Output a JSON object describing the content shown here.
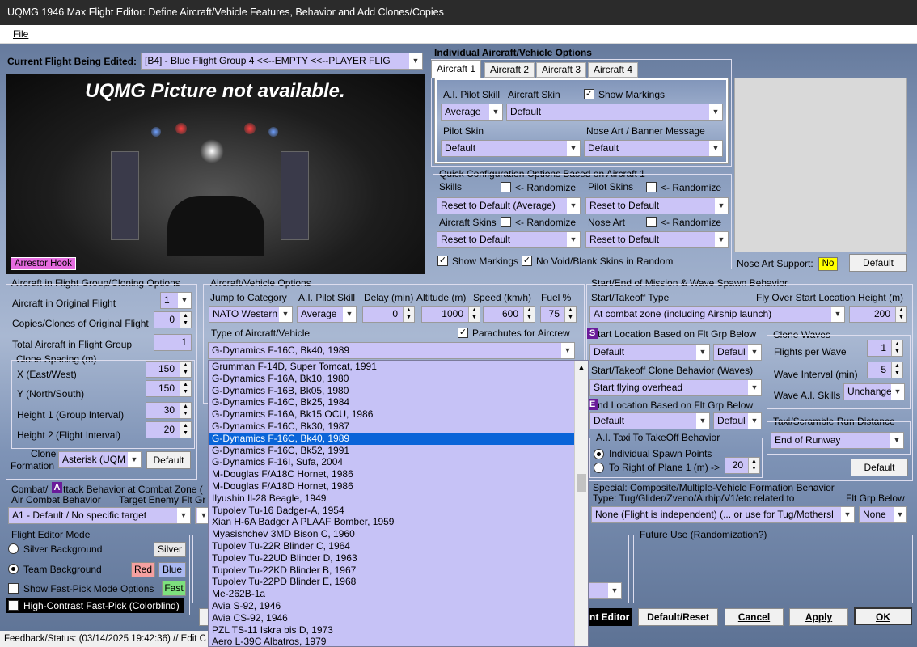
{
  "window": {
    "title": "UQMG 1946 Max Flight Editor:  Define Aircraft/Vehicle Features, Behavior and Add Clones/Copies"
  },
  "menu": {
    "file": "File"
  },
  "flight": {
    "label": "Current Flight Being Edited:",
    "value": "[B4] - Blue Flight Group  4     <<--EMPTY     <<--PLAYER FLIG"
  },
  "picture": {
    "message": "UQMG Picture not available.",
    "arrestor": "Arrestor Hook"
  },
  "individual": {
    "title": "Individual Aircraft/Vehicle Options",
    "tabs": [
      "Aircraft 1",
      "Aircraft 2",
      "Aircraft 3",
      "Aircraft 4"
    ],
    "ai_skill_label": "A.I. Pilot Skill",
    "ai_skill_value": "Average",
    "skin_label": "Aircraft Skin",
    "show_markings": "Show Markings",
    "skin_value": "Default",
    "pilot_skin_label": "Pilot Skin",
    "pilot_skin_value": "Default",
    "nose_art_label": "Nose Art / Banner Message",
    "nose_art_value": "Default"
  },
  "quick": {
    "title": "Quick Configuration Options Based on Aircraft 1",
    "skills": "Skills",
    "randomize": "<- Randomize",
    "skills_value": "Reset to Default (Average)",
    "pilot_skins": "Pilot Skins",
    "pilot_skins_value": "Reset to Default",
    "aircraft_skins": "Aircraft Skins",
    "aircraft_skins_value": "Reset to Default",
    "nose_art": "Nose Art",
    "nose_art_value": "Reset to Default",
    "show_markings": "Show Markings",
    "no_void": "No Void/Blank Skins in Random"
  },
  "noseart_support": {
    "label": "Nose Art Support:",
    "value": "No",
    "default_btn": "Default"
  },
  "cloning": {
    "title": "Aircraft in Flight Group/Cloning Options",
    "orig_label": "Aircraft in Original Flight",
    "orig_value": "1",
    "copies_label": "Copies/Clones of Original Flight",
    "copies_value": "0",
    "total_label": "Total Aircraft in Flight Group",
    "total_value": "1",
    "spacing_title": "Clone Spacing (m)",
    "x_label": "X (East/West)",
    "x_value": "150",
    "y_label": "Y (North/South)",
    "y_value": "150",
    "h1_label": "Height 1 (Group Interval)",
    "h1_value": "30",
    "h2_label": "Height 2 (Flight Interval)",
    "h2_value": "20",
    "formation_label1": "Clone",
    "formation_label2": "Formation",
    "formation_value": "Asterisk (UQM",
    "default_btn": "Default"
  },
  "vehicle": {
    "title": "Aircraft/Vehicle Options",
    "jump_label": "Jump to Category",
    "jump_value": "NATO Western",
    "skill_label": "A.I. Pilot Skill",
    "skill_value": "Average",
    "delay_label": "Delay (min)",
    "delay_value": "0",
    "alt_label": "Altitude (m)",
    "alt_value": "1000",
    "speed_label": "Speed (km/h)",
    "speed_value": "600",
    "fuel_label": "Fuel %",
    "fuel_value": "75",
    "type_label": "Type of Aircraft/Vehicle",
    "parachutes": "Parachutes for Aircrew",
    "type_value": "G-Dynamics F-16C, Bk40, 1989"
  },
  "aircraft_list": [
    "Grumman F-14D, Super Tomcat, 1991",
    "G-Dynamics F-16A, Bk10, 1980",
    "G-Dynamics F-16B, Bk05, 1980",
    "G-Dynamics F-16C, Bk25, 1984",
    "G-Dynamics F-16A, Bk15 OCU, 1986",
    "G-Dynamics F-16C, Bk30, 1987",
    "G-Dynamics F-16C, Bk40, 1989",
    "G-Dynamics F-16C, Bk52, 1991",
    "G-Dynamics F-16I, Sufa, 2004",
    "M-Douglas F/A18C Hornet, 1986",
    "M-Douglas F/A18D Hornet, 1986",
    "Ilyushin Il-28 Beagle, 1949",
    "Tupolev Tu-16 Badger-A, 1954",
    "Xian H-6A Badger A PLAAF Bomber, 1959",
    "Myasishchev 3MD Bison C, 1960",
    "Tupolev Tu-22R Blinder C, 1964",
    "Tupolev Tu-22UD Blinder D, 1963",
    "Tupolev Tu-22KD Blinder B, 1967",
    "Tupolev Tu-22PD Blinder E, 1968",
    "Me-262B-1a",
    "Avia S-92, 1946",
    "Avia CS-92, 1946",
    "PZL TS-11 Iskra bis D, 1973",
    "Aero L-39C Albatros, 1979"
  ],
  "combat": {
    "title": "Combat/",
    "title2": "ttack Behavior at Combat Zone (",
    "air_label": "Air Combat Behavior",
    "target_label": "Target Enemy Flt Gr",
    "air_value": "A1 - Default / No specific target"
  },
  "mode": {
    "title": "Flight Editor Mode",
    "silver_bg": "Silver Background",
    "silver_btn": "Silver",
    "team_bg": "Team Background",
    "red_btn": "Red",
    "blue_btn": "Blue",
    "fastpick": "Show Fast-Pick Mode Options",
    "fast_btn": "Fast",
    "contrast": "High-Contrast Fast-Pick (Colorblind)"
  },
  "spawn": {
    "title": "Start/End of Mission & Wave Spawn Behavior",
    "takeoff_label": "Start/Takeoff Type",
    "height_label": "Fly Over Start Location Height (m)",
    "takeoff_value": "At combat zone (including Airship launch)",
    "height_value": "200",
    "start_loc_label": "tart Location Based on Flt Grp Below",
    "start_loc_value": "Default",
    "start_loc_value2": "Defaul",
    "clone_behavior_label": "Start/Takeoff Clone Behavior (Waves)",
    "clone_behavior_value": "Start flying overhead",
    "end_loc_label": "nd Location Based on Flt Grp Below",
    "end_loc_value": "Default",
    "end_loc_value2": "Defaul",
    "taxi_title": "A.I. Taxi To TakeOff Behavior",
    "individual": "Individual Spawn Points",
    "right_of": "To Right of Plane 1 (m) ->",
    "right_value": "20",
    "waves_title": "Clone Waves",
    "flights_label": "Flights per Wave",
    "flights_value": "1",
    "interval_label": "Wave Interval (min)",
    "interval_value": "5",
    "wave_skill_label": "Wave A.I. Skills",
    "wave_skill_value": "Unchange",
    "scramble_title": "Taxi/Scramble Run Distance",
    "scramble_value": "End of Runway",
    "default_btn": "Default"
  },
  "special": {
    "title": "Special: Composite/Multiple-Vehicle Formation Behavior",
    "type_label": "Type: Tug/Glider/Zveno/Airhip/V1/etc related to",
    "flt_label": "Flt Grp Below",
    "type_value": "None (Flight is independent) (... or use for Tug/Mothersl",
    "flt_value": "None"
  },
  "future": {
    "title": "Future Use (Randomization?)"
  },
  "buttons": {
    "editor": "nt Editor",
    "default_reset": "Default/Reset",
    "cancel": "Cancel",
    "apply": "Apply",
    "ok": "OK"
  },
  "status": {
    "text": "Feedback/Status:  (03/14/2025 19:42:36) // Edit C"
  },
  "colors": {
    "selected": "#0a64d8",
    "list_bg": "#c6c2f6",
    "badge": "#6a1b9a",
    "nose_no": "#ffff00",
    "red_btn": "#f5a0a0",
    "blue_btn": "#aab8f0",
    "fast_btn": "#7de07d",
    "arrestor": "#e56be0"
  }
}
